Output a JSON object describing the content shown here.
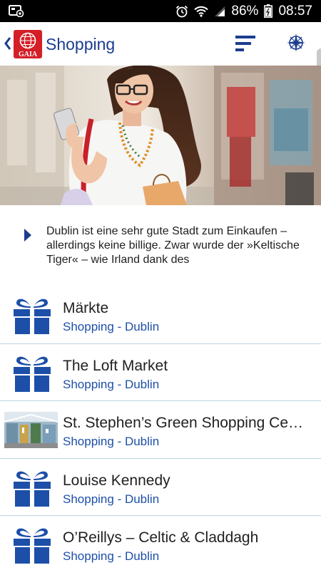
{
  "status_bar": {
    "battery_percent": "86%",
    "time": "08:57",
    "icons": [
      "screenshot-icon",
      "alarm-icon",
      "wifi-icon",
      "signal-icon",
      "battery-icon"
    ]
  },
  "app_bar": {
    "logo_text": "GAIA",
    "title": "Shopping",
    "icons": [
      "back-chevron-icon",
      "filter-icon",
      "compass-icon"
    ],
    "accent_color": "#1a3d8f"
  },
  "intro": {
    "text": "Dublin ist eine sehr gute Stadt zum Einkaufen – allerdings keine billige. Zwar wurde der »Keltische Tiger« – wie Irland dank des"
  },
  "list": {
    "items": [
      {
        "title": "Märkte",
        "subtitle": "Shopping - Dublin",
        "icon": "gift-icon"
      },
      {
        "title": "The Loft Market",
        "subtitle": "Shopping - Dublin",
        "icon": "gift-icon"
      },
      {
        "title": "St. Stephen’s Green Shopping Ce…",
        "subtitle": "Shopping - Dublin",
        "icon": "thumbnail"
      },
      {
        "title": "Louise Kennedy",
        "subtitle": "Shopping - Dublin",
        "icon": "gift-icon"
      },
      {
        "title": "O’Reillys – Celtic & Claddagh",
        "subtitle": "Shopping - Dublin",
        "icon": "gift-icon"
      }
    ]
  }
}
